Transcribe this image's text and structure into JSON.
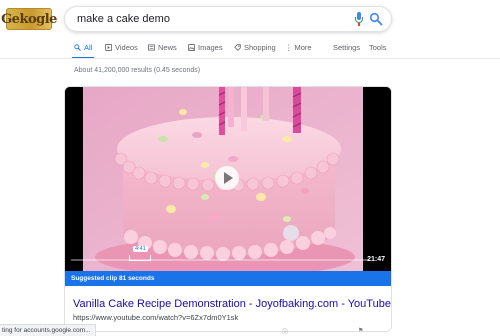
{
  "logo": {
    "text": "Gekogle"
  },
  "search": {
    "query": "make a cake demo"
  },
  "tabs": [
    {
      "label": "All"
    },
    {
      "label": "Videos"
    },
    {
      "label": "News"
    },
    {
      "label": "Images"
    },
    {
      "label": "Shopping"
    },
    {
      "label": "More"
    }
  ],
  "tools": {
    "settings": "Settings",
    "tools": "Tools"
  },
  "stats": "About 41,200,000 results (0.45 seconds)",
  "video": {
    "clip_start": "4:41",
    "duration": "21:47",
    "clip_label": "Suggested clip 81 seconds"
  },
  "result": {
    "title": "Vanilla Cake Recipe Demonstration - Joyofbaking.com - YouTube",
    "url": "https://www.youtube.com/watch?v=6Zx7dm0Y1sk"
  },
  "status_bar": {
    "text": "ting for accounts.google.com..."
  },
  "colors": {
    "accent": "#1a73e8",
    "link": "#1a0dab",
    "banner": "#1a73e8",
    "frosting": "#f3b6cc"
  }
}
